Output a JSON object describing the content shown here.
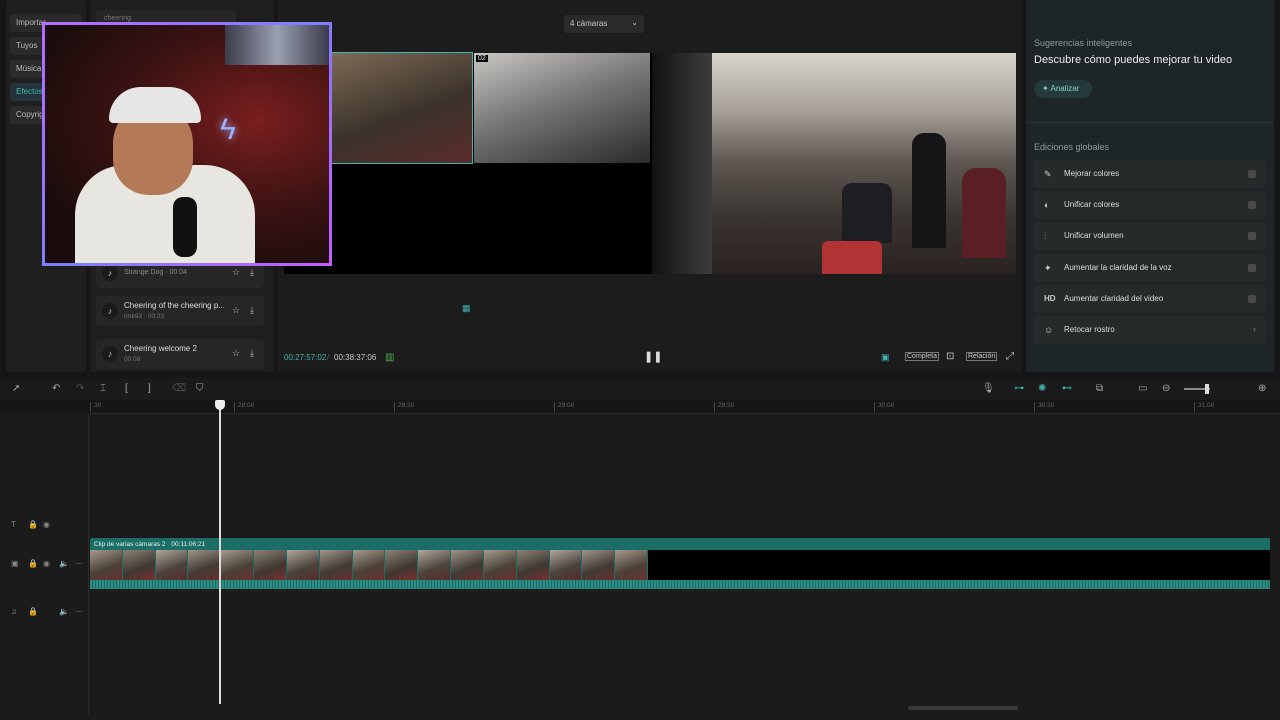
{
  "nav": {
    "items": [
      "Importar",
      "Tuyos",
      "Música",
      "Efectos",
      "Copyright"
    ],
    "active": "Efectos"
  },
  "library": {
    "search_value": "cheering",
    "sounds": [
      {
        "title": "Strange Dog · 00:04",
        "sub": ""
      },
      {
        "title": "Cheering of the cheering p...",
        "sub": "rmk93 · 00:23"
      },
      {
        "title": "Cheering welcome 2",
        "sub": "00:08"
      }
    ]
  },
  "player": {
    "camera_select": "4 cámaras",
    "current_time": "00:27:57:02",
    "total_time": "00:38:37:06",
    "cam_badge": "02",
    "buttons": {
      "full": "Completa",
      "ratio": "Relación"
    }
  },
  "smart": {
    "header": "Sugerencias inteligentes",
    "title": "Descubre cómo puedes mejorar tu video",
    "analyze": "Analizar",
    "global_header": "Ediciones globales",
    "items": [
      {
        "icon": "✎",
        "label": "Mejorar colores"
      },
      {
        "icon": "◐",
        "label": "Unificar colores"
      },
      {
        "icon": "⫶",
        "label": "Unificar volumen"
      },
      {
        "icon": "✦",
        "label": "Aumentar la claridad de la voz"
      },
      {
        "icon": "HD",
        "label": "Aumentar claridad del video"
      },
      {
        "icon": "☺",
        "label": "Retocar rostro"
      }
    ]
  },
  "timeline": {
    "ticks": [
      "30",
      "28:00",
      "28:30",
      "29:00",
      "29:30",
      "30:00",
      "30:30",
      "31:00"
    ],
    "clip_label": "Clip de varias cámaras 2",
    "clip_duration": "00:11:06:21"
  },
  "colors": {
    "accent": "#3fb6b3",
    "clip": "#1b6d66",
    "webcam_border": "#b56cff"
  }
}
